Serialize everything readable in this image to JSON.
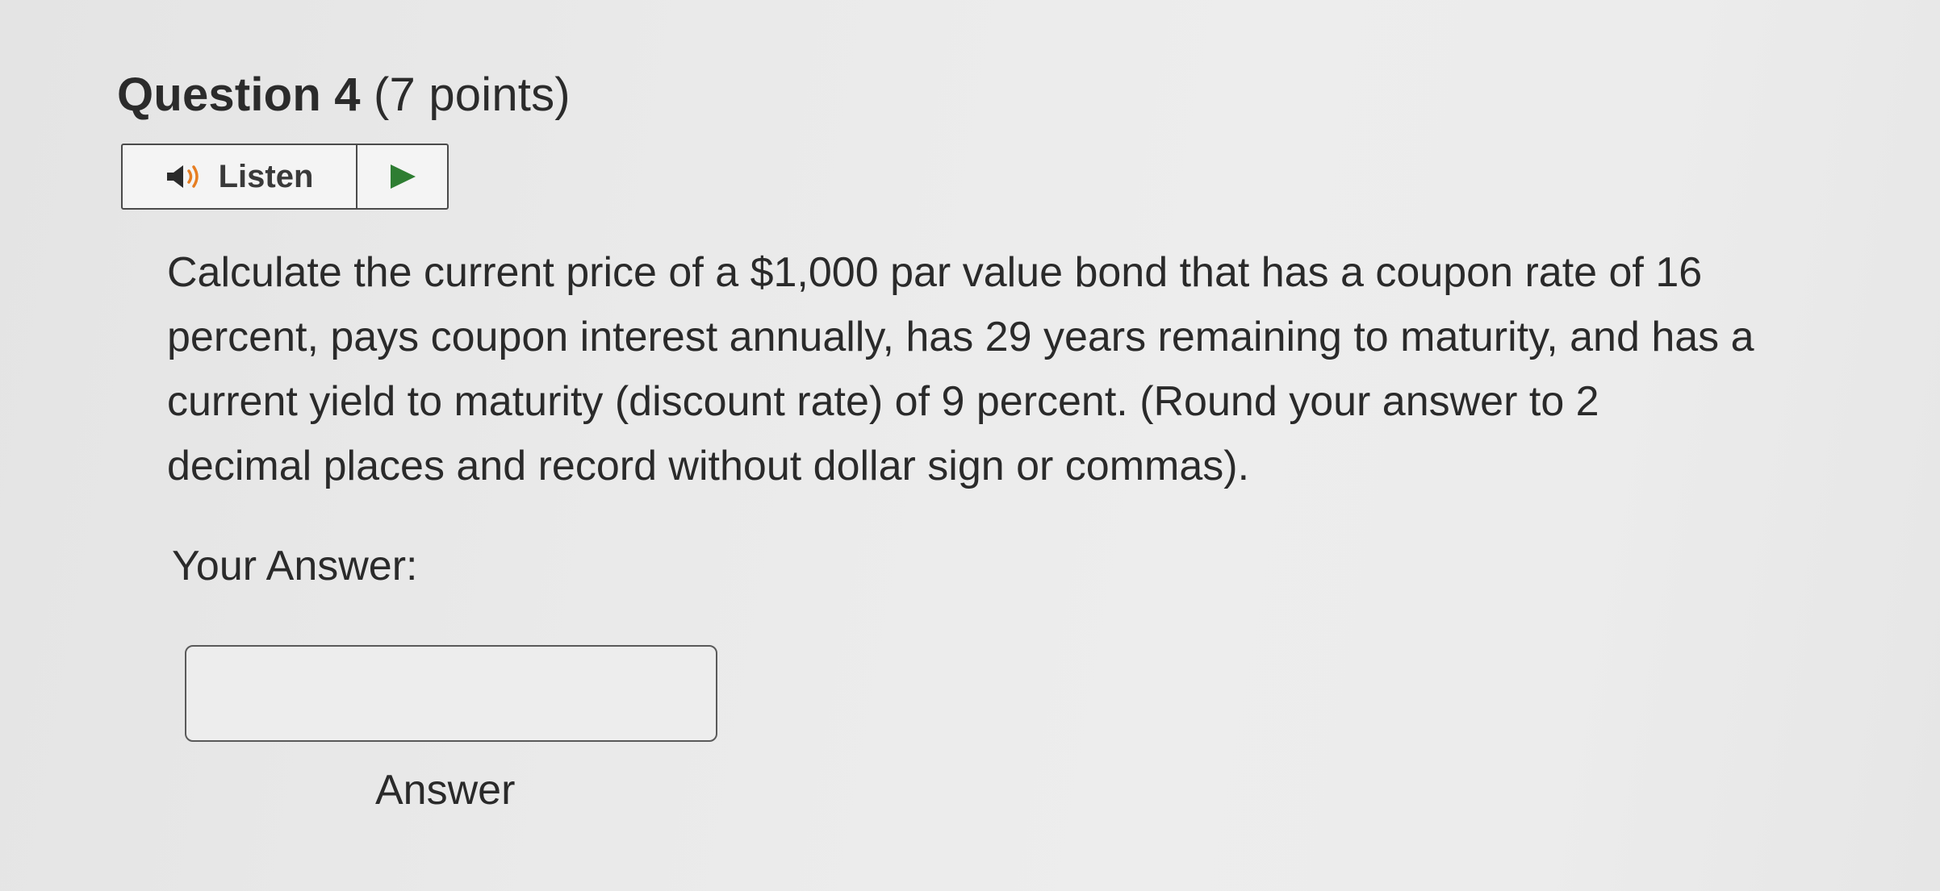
{
  "question": {
    "name": "Question 4",
    "points": "(7 points)"
  },
  "listen": {
    "label": "Listen",
    "speaker_icon": "speaker-icon",
    "play_icon": "play-icon"
  },
  "question_text": {
    "lines": [
      "Calculate the current price of a $1,000 par value bond that has a coupon rate of 16",
      "percent, pays coupon interest annually, has 29 years remaining to maturity, and has a",
      "current yield to maturity (discount rate) of 9 percent. (Round your answer to 2",
      "decimal places and record without dollar sign or commas)."
    ]
  },
  "answer": {
    "prompt": "Your Answer:",
    "value": "",
    "placeholder": "",
    "caption": "Answer"
  },
  "colors": {
    "play_icon": "#2e7d32",
    "text": "#2a2a2a",
    "background": "#eaeaea"
  }
}
